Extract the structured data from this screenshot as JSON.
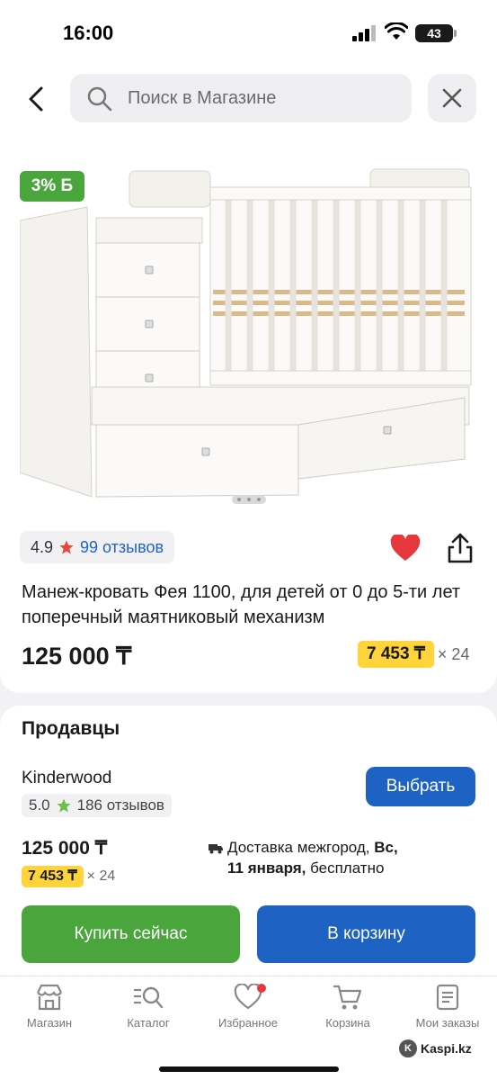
{
  "status_bar": {
    "time": "16:00",
    "battery": "43"
  },
  "search": {
    "placeholder": "Поиск в Магазине"
  },
  "product": {
    "discount_badge": "3% Б",
    "rating": "4.9",
    "reviews": "99 отзывов",
    "title": "Манеж-кровать Фея 1100, для детей от 0 до 5-ти лет поперечный маятниковый механизм",
    "price": "125 000 ₸",
    "installment_price": "7 453 ₸",
    "installment_months": "× 24",
    "image_slide": {
      "current": 1,
      "total": 3
    }
  },
  "sellers": {
    "heading": "Продавцы",
    "seller_name": "Kinderwood",
    "seller_rating": "5.0",
    "seller_reviews": "186 отзывов",
    "choose_label": "Выбрать",
    "price": "125 000 ₸",
    "installment_price": "7 453 ₸",
    "installment_months": "× 24",
    "delivery_prefix": "Доставка межгород, ",
    "delivery_day": "Вс,",
    "delivery_date": "11 января,",
    "delivery_suffix": " бесплатно"
  },
  "actions": {
    "buy_now": "Купить сейчас",
    "add_to_cart": "В корзину"
  },
  "nav": {
    "items": [
      {
        "label": "Магазин",
        "icon": "shop-icon"
      },
      {
        "label": "Каталог",
        "icon": "catalog-icon"
      },
      {
        "label": "Избранное",
        "icon": "heart-icon"
      },
      {
        "label": "Корзина",
        "icon": "cart-icon"
      },
      {
        "label": "Мои заказы",
        "icon": "orders-icon"
      }
    ]
  },
  "watermark": "Kaspi.kz",
  "colors": {
    "green": "#4aa53c",
    "blue": "#1e63c4",
    "yellow": "#ffd43b",
    "red": "#e8383d",
    "link": "#1f63c6"
  }
}
